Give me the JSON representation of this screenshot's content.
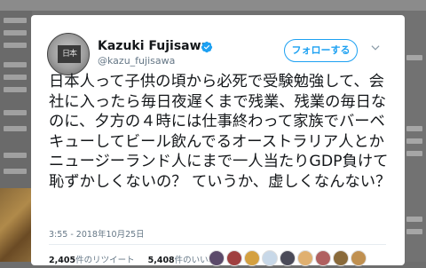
{
  "tweet": {
    "author_name": "Kazuki Fujisawa",
    "author_handle": "@kazu_fujisawa",
    "follow_label": "フォローする",
    "text": "日本人って子供の頃から必死で受験勉強して、会社に入ったら毎日夜遅くまで残業、残業の毎日なのに、夕方の４時には仕事終わって家族でバーベキューしてビール飲んでるオーストラリア人とかニュージーランド人にまで一人当たりGDP負けて恥ずかしくないの？ ていうか、虚しくなんない？",
    "timestamp": "3:55 - 2018年10月25日",
    "retweets_count": "2,405",
    "retweets_label": "件のリツイート",
    "likes_count": "5,408",
    "likes_label": "件のいいね",
    "avatar_kanji": "日本"
  },
  "liker_avatars": [
    {
      "name": "liker-avatar-1",
      "color": "#5b4a6a"
    },
    {
      "name": "liker-avatar-2",
      "color": "#a04040"
    },
    {
      "name": "liker-avatar-3",
      "color": "#d4a040"
    },
    {
      "name": "liker-avatar-4",
      "color": "#c8d8e8"
    },
    {
      "name": "liker-avatar-5",
      "color": "#4a4a58"
    },
    {
      "name": "liker-avatar-6",
      "color": "#e0b070"
    },
    {
      "name": "liker-avatar-7",
      "color": "#b06060"
    },
    {
      "name": "liker-avatar-8",
      "color": "#8a6a3a"
    },
    {
      "name": "liker-avatar-9",
      "color": "#c09050"
    }
  ],
  "colors": {
    "accent": "#1da1f2",
    "text": "#14171a",
    "muted": "#657786"
  }
}
